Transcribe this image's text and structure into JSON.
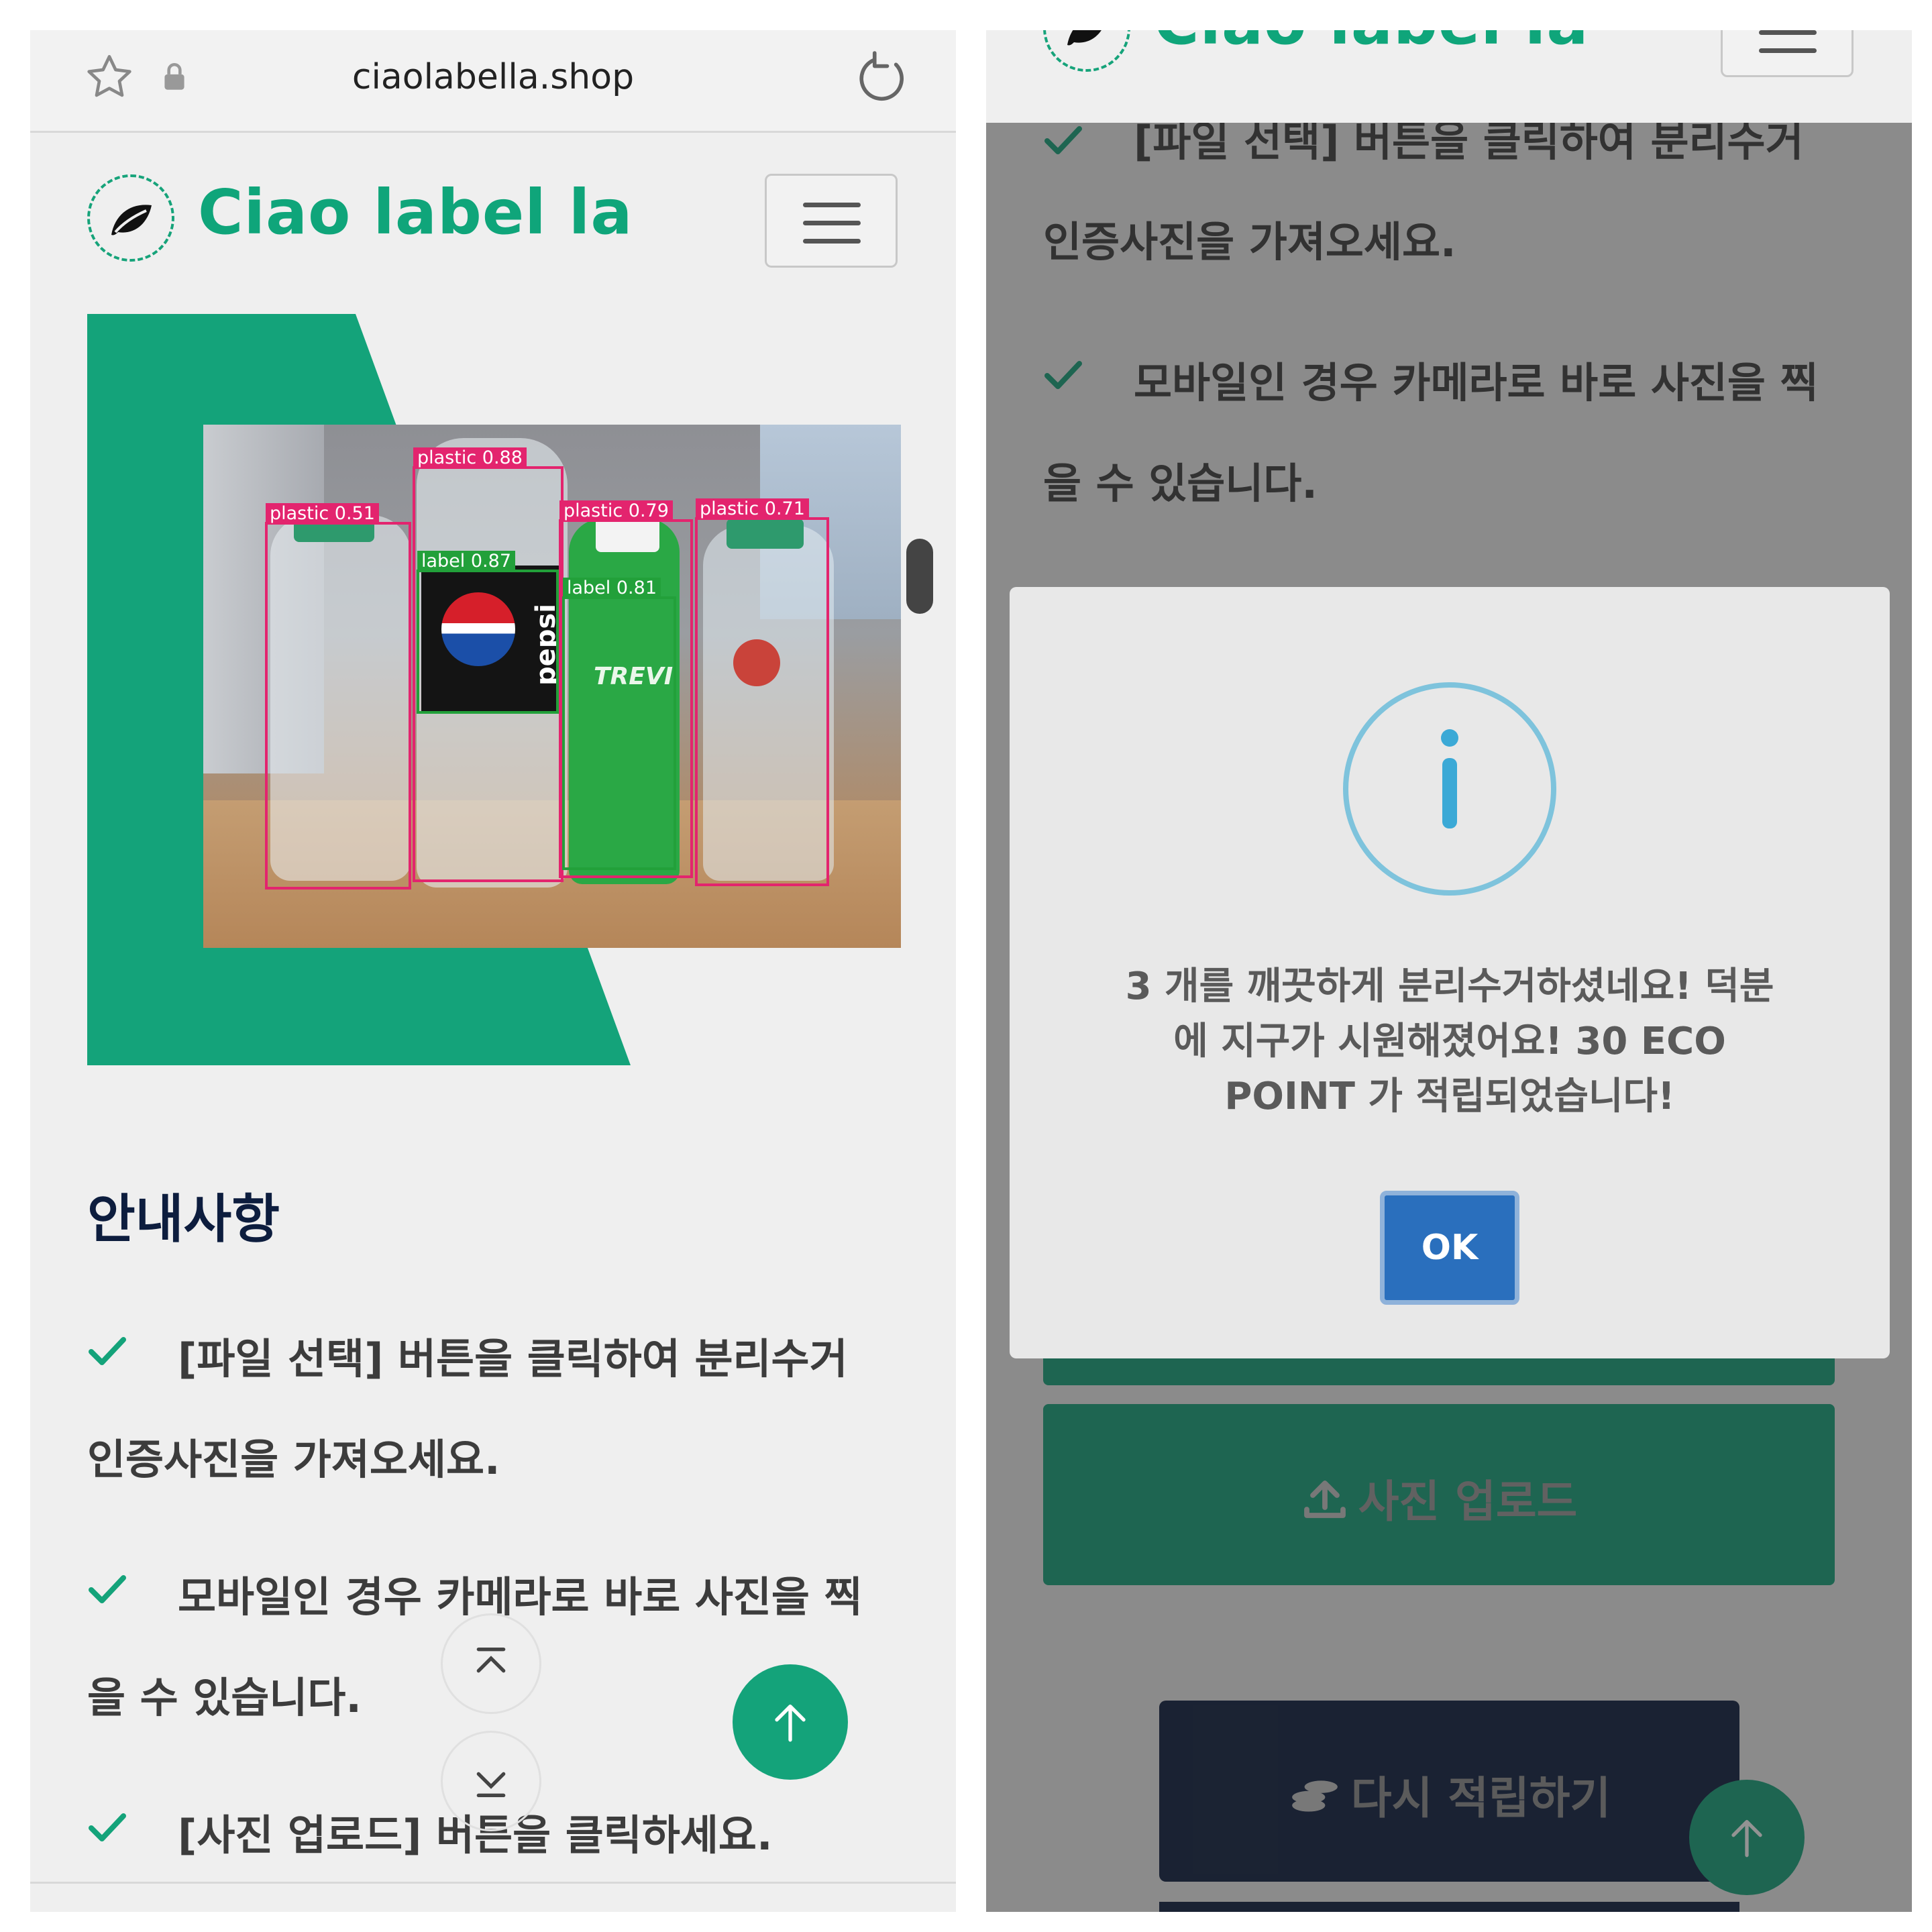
{
  "browser": {
    "url": "ciaolabella.shop"
  },
  "site": {
    "brand": "Ciao label la"
  },
  "detections": [
    {
      "label": "plastic 0.51",
      "cls": "plastic"
    },
    {
      "label": "plastic 0.88",
      "cls": "plastic"
    },
    {
      "label": "label 0.87",
      "cls": "label"
    },
    {
      "label": "plastic 0.79",
      "cls": "plastic"
    },
    {
      "label": "label 0.81",
      "cls": "label"
    },
    {
      "label": "plastic 0.71",
      "cls": "plastic"
    }
  ],
  "bottle_text": {
    "pepsi": "pepsi",
    "trevi": "TREVI"
  },
  "guide": {
    "title": "안내사항",
    "items": [
      "[파일 선택] 버튼을 클릭하여 분리수거",
      "인증사진을 가져오세요.",
      "모바일인 경우 카메라로 바로 사진을 찍",
      "을 수 있습니다.",
      "[사진 업로드] 버튼을 클릭하세요."
    ]
  },
  "right": {
    "brand_partial": "Ciao label la",
    "guide_items": [
      "[파일 선택] 버튼을 클릭하여 분리수거",
      "인증사진을 가져오세요.",
      "모바일인 경우 카메라로 바로 사진을 찍",
      "을 수 있습니다."
    ],
    "modal": {
      "icon": "info-icon",
      "message_lines": [
        "3 개를 깨끗하게 분리수거하셨네요! 덕분",
        "에 지구가 시원해졌어요! 30 ECO",
        "POINT 가 적립되었습니다!"
      ],
      "ok_label": "OK"
    },
    "upload_label": "사진 업로드",
    "again_label": "다시 적립하기"
  },
  "colors": {
    "brand_green": "#0fa57a",
    "dark_navy": "#0d1d3e",
    "ok_blue": "#2a6fbd",
    "info_ring": "#7ec3dc"
  }
}
